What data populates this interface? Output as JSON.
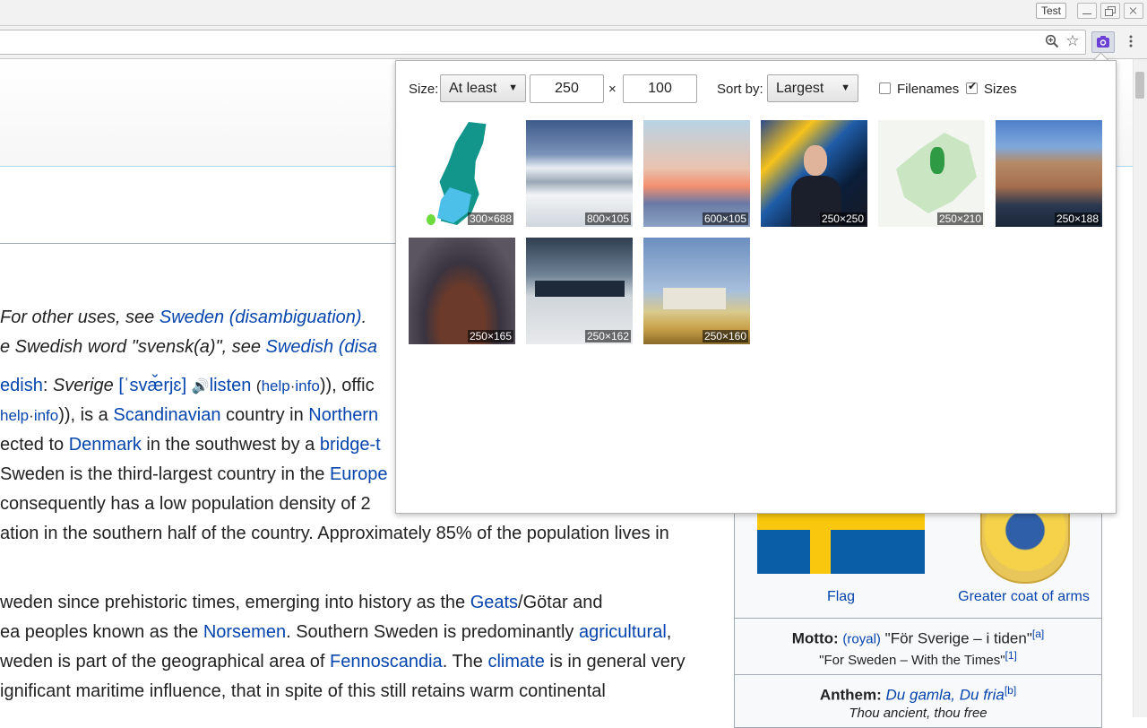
{
  "window": {
    "profile_button": "Test"
  },
  "toolbar": {
    "zoom_icon": "zoom-in-icon",
    "star_icon": "bookmark-star-icon",
    "extension_icon": "image-grabber-extension-icon",
    "menu_icon": "kebab-menu-icon"
  },
  "page": {
    "hatnote1": {
      "pre": "For other uses, see ",
      "link": "Sweden (disambiguation)",
      "post": "."
    },
    "hatnote2": {
      "pre": "e Swedish word \"svensk(a)\", see ",
      "link": "Swedish (disa"
    },
    "line1": {
      "a": "edish",
      "b": ": ",
      "c": "Sverige",
      "d": "[ˈsvæ̌rjɛ]",
      "e": "listen",
      "f": "(",
      "g": "help",
      "h": "·",
      "i": "info",
      "j": ")), offic"
    },
    "line2": {
      "a": "help",
      "b": "·",
      "c": "info",
      "d": ")), is a ",
      "e": "Scandinavian",
      "f": " country in ",
      "g": "Northern"
    },
    "line3": {
      "a": "ected to ",
      "b": "Denmark",
      "c": " in the southwest by a ",
      "d": "bridge-t"
    },
    "line4": {
      "a": "Sweden is the third-largest country in the ",
      "b": "Europe"
    },
    "line5": {
      "a": " consequently has a low population density of 2"
    },
    "line6": {
      "a": "ation in the southern half of the country. Approximately 85% of the population lives in"
    },
    "line7": {
      "a": "weden since prehistoric times, emerging into history as the ",
      "b": "Geats",
      "c": "/Götar and"
    },
    "line8": {
      "a": "ea peoples known as the ",
      "b": "Norsemen",
      "c": ". Southern Sweden is predominantly ",
      "d": "agricultural",
      "e": ","
    },
    "line9": {
      "a": "weden is part of the geographical area of ",
      "b": "Fennoscandia",
      "c": ". The ",
      "d": "climate",
      "e": " is in general very"
    },
    "line10": {
      "a": "ignificant maritime influence, that in spite of this still retains warm continental"
    }
  },
  "infobox": {
    "flag_caption": "Flag",
    "coat_caption": "Greater coat of arms",
    "motto_label": "Motto:",
    "motto_royal": "(royal)",
    "motto_text": "\"För Sverige – i tiden\"",
    "motto_ref": "[a]",
    "motto_translation": "\"For Sweden – With the Times\"",
    "motto_translation_ref": "[1]",
    "anthem_label": "Anthem:",
    "anthem_name": "Du gamla, Du fria",
    "anthem_ref": "[b]",
    "anthem_translation": "Thou ancient, thou free"
  },
  "popup": {
    "size_label": "Size:",
    "size_mode": "At least",
    "width_value": "250",
    "times_symbol": "×",
    "height_value": "100",
    "sort_label": "Sort by:",
    "sort_value": "Largest",
    "filenames_label": "Filenames",
    "filenames_checked": false,
    "sizes_label": "Sizes",
    "sizes_checked": true,
    "images": [
      {
        "size": "300×688"
      },
      {
        "size": "800×105"
      },
      {
        "size": "600×105"
      },
      {
        "size": "250×250"
      },
      {
        "size": "250×210"
      },
      {
        "size": "250×188"
      },
      {
        "size": "250×165"
      },
      {
        "size": "250×162"
      },
      {
        "size": "250×160"
      }
    ]
  }
}
